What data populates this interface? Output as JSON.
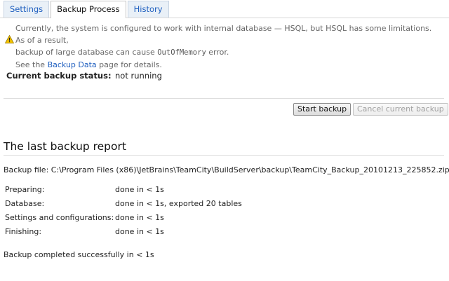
{
  "tabs": [
    {
      "label": "Settings",
      "active": false
    },
    {
      "label": "Backup Process",
      "active": true
    },
    {
      "label": "History",
      "active": false
    }
  ],
  "warning": {
    "icon": "warning-icon",
    "line1": "Currently, the system is configured to work with internal database — HSQL, but HSQL has some limitations. As of a result,",
    "line2_prefix": "backup of large database can cause ",
    "line2_code": "OutOfMemory",
    "line2_suffix": " error.",
    "line3_prefix": "See the ",
    "line3_link": "Backup Data",
    "line3_suffix": " page for details."
  },
  "status": {
    "label": "Current backup status:",
    "value": "not running"
  },
  "buttons": {
    "start": "Start backup",
    "cancel": "Cancel current backup"
  },
  "report": {
    "title": "The last backup report",
    "file_label": "Backup file:",
    "file_path": "C:\\Program Files (x86)\\JetBrains\\TeamCity\\BuildServer\\backup\\TeamCity_Backup_20101213_225852.zip",
    "rows": [
      {
        "label": "Preparing:",
        "value": "done in < 1s"
      },
      {
        "label": "Database:",
        "value": "done in < 1s, exported 20 tables"
      },
      {
        "label": "Settings and configurations:",
        "value": "done in < 1s"
      },
      {
        "label": "Finishing:",
        "value": "done in < 1s"
      }
    ],
    "completed": "Backup completed successfully in < 1s"
  },
  "colors": {
    "link": "#1f5fbf",
    "warning": "#f2c200"
  }
}
